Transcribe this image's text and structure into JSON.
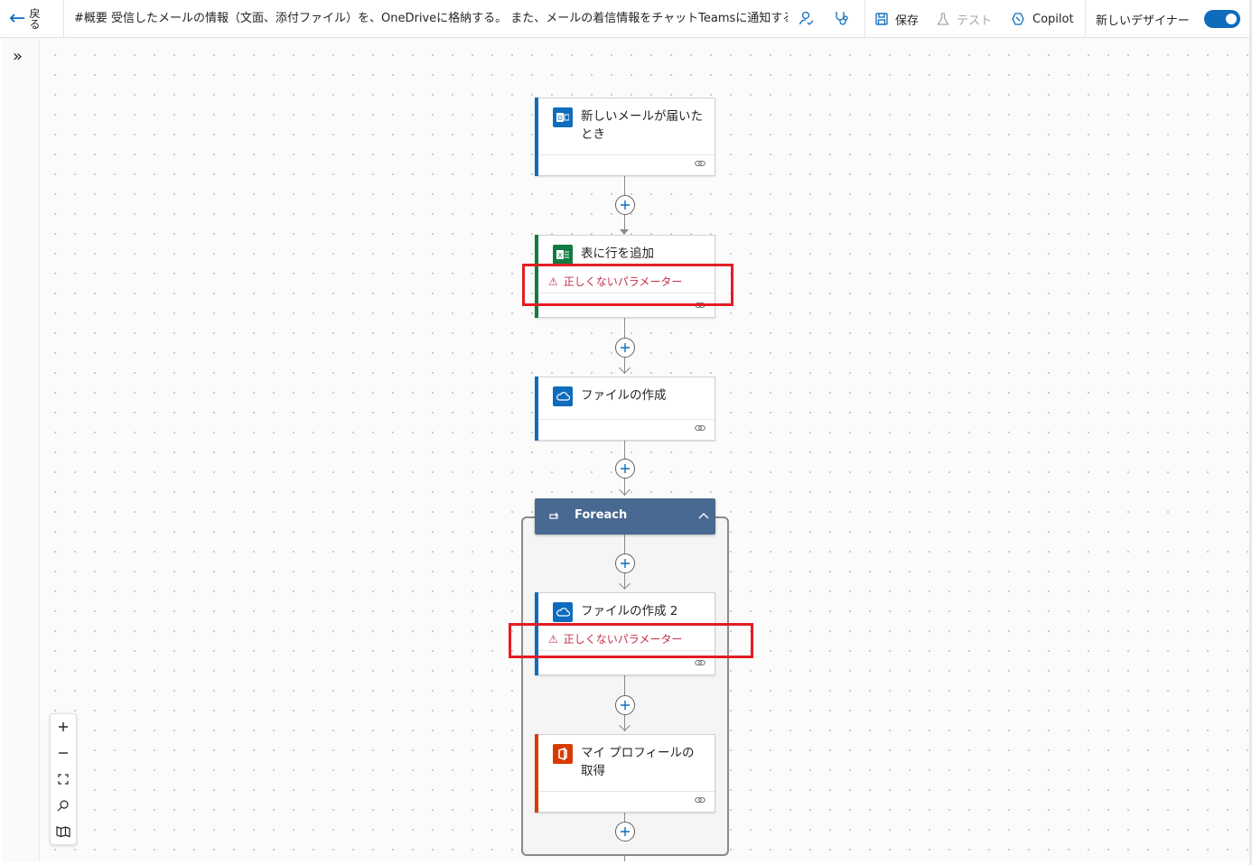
{
  "topbar": {
    "back_label": "戻る",
    "flow_title": "#概要 受信したメールの情報（文面、添付ファイル）を、OneDriveに格納する。 また、メールの着信情報をチャットTeamsに通知する。",
    "save_label": "保存",
    "test_label": "テスト",
    "copilot_label": "Copilot",
    "new_designer_label": "新しいデザイナー"
  },
  "canvas": {
    "cards": [
      {
        "title": "新しいメールが届いたとき",
        "connector": "outlook",
        "accent": "#0f6cbd"
      },
      {
        "title": "表に行を追加",
        "connector": "excel",
        "accent": "#107c41",
        "error": "正しくないパラメーター"
      },
      {
        "title": "ファイルの作成",
        "connector": "onedrive",
        "accent": "#0f6cbd"
      }
    ],
    "foreach": {
      "title": "Foreach",
      "color": "#486991",
      "cards": [
        {
          "title": "ファイルの作成 2",
          "connector": "onedrive",
          "accent": "#0f6cbd",
          "error": "正しくないパラメーター"
        },
        {
          "title": "マイ プロフィールの取得",
          "connector": "office365",
          "accent": "#d83b01"
        }
      ]
    },
    "error_symbol": "⚠"
  },
  "highlight_color": "#e31d23"
}
